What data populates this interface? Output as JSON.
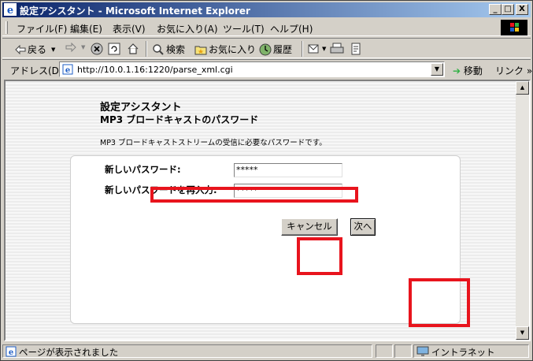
{
  "window": {
    "title": "設定アシスタント - Microsoft Internet Explorer",
    "minimize": "_",
    "maximize": "□",
    "close": "X"
  },
  "menu": {
    "items": [
      "ファイル(F)",
      "編集(E)",
      "表示(V)",
      "お気に入り(A)",
      "ツール(T)",
      "ヘルプ(H)"
    ]
  },
  "toolbar": {
    "back": "戻る",
    "search": "検索",
    "favorites": "お気に入り",
    "history": "履歴"
  },
  "address": {
    "label": "アドレス(D)",
    "url": "http://10.0.1.16:1220/parse_xml.cgi",
    "go": "移動",
    "links": "リンク »"
  },
  "page": {
    "assistant_title": "設定アシスタント",
    "section_title": "MP3 ブロードキャストのパスワード",
    "description": "MP3 ブロードキャストストリームの受信に必要なパスワードです。",
    "new_password_label": "新しいパスワード:",
    "confirm_password_label": "新しいパスワードを再入力:",
    "new_password_value": "*****",
    "confirm_password_value": "*****",
    "cancel_label": "キャンセル",
    "next_label": "次へ"
  },
  "status": {
    "text": "ページが表示されました",
    "zone": "イントラネット"
  },
  "colors": {
    "highlight": "#e8141d",
    "titlebar_start": "#0a246a",
    "titlebar_end": "#a6caf0"
  }
}
